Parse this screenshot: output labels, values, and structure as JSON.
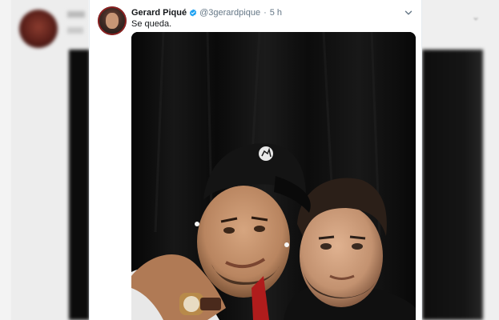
{
  "tweet": {
    "author_name": "Gerard Piqué",
    "handle": "@3gerardpique",
    "separator": "·",
    "time": "5 h",
    "text": "Se queda.",
    "verified": true,
    "accent_color": "#1da1f2"
  },
  "icons": {
    "verified": "verified-badge-icon",
    "caret": "chevron-down-icon"
  },
  "photo": {
    "hat_logo": "prancing-horse-logo"
  }
}
